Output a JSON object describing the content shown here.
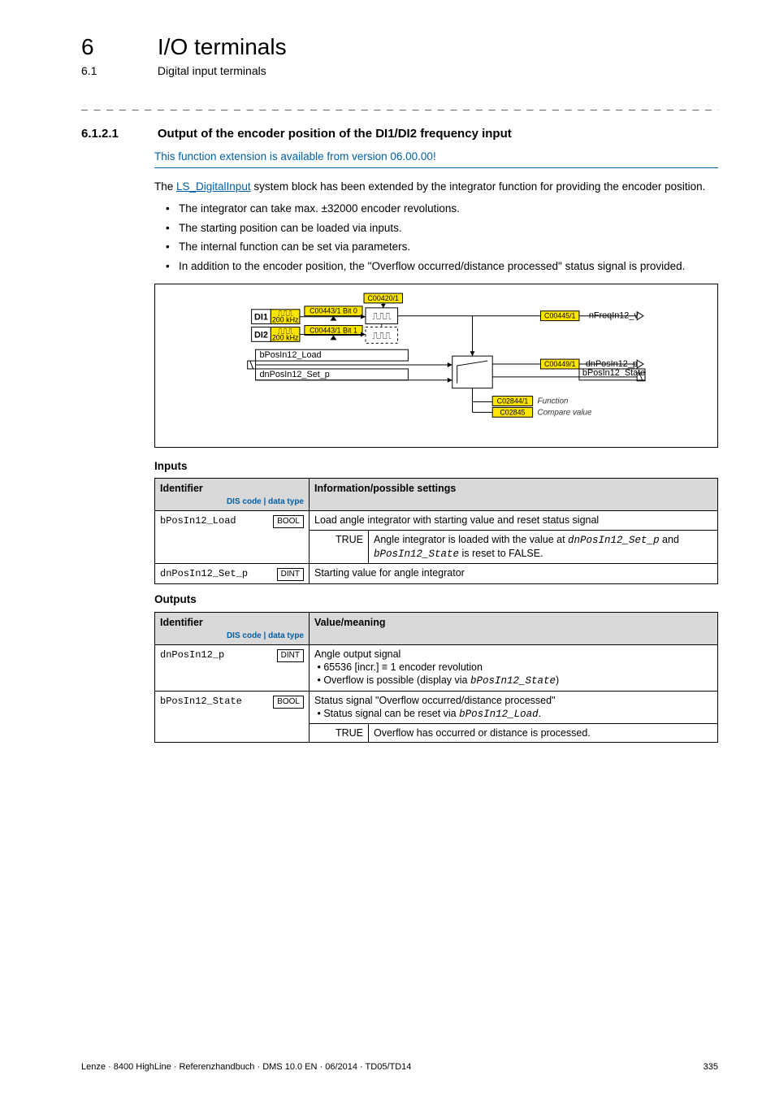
{
  "header": {
    "section_num": "6",
    "section_title": "I/O terminals",
    "sub_num": "6.1",
    "sub_title": "Digital input terminals"
  },
  "dash_line": "_ _ _ _ _ _ _ _ _ _ _ _ _ _ _ _ _ _ _ _ _ _ _ _ _ _ _ _ _ _ _ _ _ _ _ _ _ _ _ _ _ _ _ _ _ _ _ _ _ _ _ _ _ _ _ _ _ _ _ _ _ _ _ _",
  "subheading": {
    "num": "6.1.2.1",
    "title": "Output of the encoder position of the DI1/DI2 frequency input"
  },
  "blue_note": "This function extension is available from version 06.00.00!",
  "intro": {
    "pre": "The ",
    "link": "LS_DigitalInput",
    "post": " system block has been extended by the integrator function for providing the encoder position."
  },
  "bullets": [
    "The integrator can take max. ±32000 encoder revolutions.",
    "The starting position can be loaded via inputs.",
    "The internal function can be set via parameters.",
    "In addition to the encoder position, the \"Overflow occurred/distance processed\" status signal is provided."
  ],
  "diagram": {
    "di1": "DI1",
    "di2": "DI2",
    "hz": "200 kHz",
    "c00443_b0": "C00443/1 Bit 0",
    "c00443_b1": "C00443/1 Bit 1",
    "c00420": "C00420/1",
    "c00445": "C00445/1",
    "nFreqIn12_v": "nFreqIn12_v",
    "bPosIn12_Load": "bPosIn12_Load",
    "dnPosIn12_Set_p": "dnPosIn12_Set_p",
    "c00449": "C00449/1",
    "dnPosIn12_p": "dnPosIn12_p",
    "bPosIn12_State": "bPosIn12_State",
    "c02844": "C02844/1",
    "function": "Function",
    "c02845": "C02845",
    "compare": "Compare value"
  },
  "inputs": {
    "heading": "Inputs",
    "col_identifier": "Identifier",
    "col_dhint": "DIS code | data type",
    "col_info": "Information/possible settings",
    "rows": [
      {
        "name": "bPosIn12_Load",
        "dtype": "BOOL",
        "desc": "Load angle integrator with starting value and reset status signal",
        "key": "TRUE",
        "keydesc_pre": "Angle integrator is loaded with the value at ",
        "keydesc_em1": "dnPosIn12_Set_p",
        "keydesc_mid": " and ",
        "keydesc_em2": "bPosIn12_State",
        "keydesc_post": " is reset to FALSE."
      },
      {
        "name": "dnPosIn12_Set_p",
        "dtype": "DINT",
        "desc": "Starting value for angle integrator"
      }
    ]
  },
  "outputs": {
    "heading": "Outputs",
    "col_identifier": "Identifier",
    "col_dhint": "DIS code | data type",
    "col_info": "Value/meaning",
    "rows": [
      {
        "name": "dnPosIn12_p",
        "dtype": "DINT",
        "desc_line1": "Angle output signal",
        "desc_b1": "65536 [incr.] ≡ 1 encoder revolution",
        "desc_b2_pre": "Overflow is possible (display via ",
        "desc_b2_em": "bPosIn12_State",
        "desc_b2_post": ")"
      },
      {
        "name": "bPosIn12_State",
        "dtype": "BOOL",
        "desc_line1": "Status signal \"Overflow occurred/distance processed\"",
        "desc_b1_pre": "Status signal can be reset via ",
        "desc_b1_em": "bPosIn12_Load",
        "desc_b1_post": ".",
        "key": "TRUE",
        "keydesc": "Overflow has occurred or distance is processed."
      }
    ]
  },
  "footer": {
    "left": "Lenze · 8400 HighLine · Referenzhandbuch · DMS 10.0 EN · 06/2014 · TD05/TD14",
    "right": "335"
  }
}
